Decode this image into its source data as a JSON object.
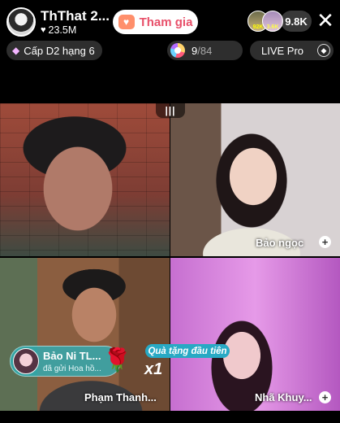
{
  "header": {
    "host_name": "ThThat 2...",
    "host_likes": "23.5M",
    "join_label": "Tham gia",
    "viewer_avatars": [
      "92K",
      "3.6K"
    ],
    "viewer_count": "9.8K",
    "close_label": "✕"
  },
  "badges": {
    "level_label": "Cấp D2 hạng 6",
    "progress_current": "9",
    "progress_total": "/84",
    "live_pro_label": "LIVE Pro"
  },
  "grid": {
    "divider_label": "|||",
    "tiles": [
      {
        "name": ""
      },
      {
        "name": "Bảo ngọc"
      },
      {
        "name": "Phạm Thanh..."
      },
      {
        "name": "Nhã Khuy..."
      }
    ]
  },
  "gift": {
    "sender": "Bảo Ni TL...",
    "message": "đã gửi Hoa hồ...",
    "multiplier": "x1",
    "first_gift_label": "Quà tặng đầu tiên"
  },
  "icons": {
    "heart": "♥",
    "diamond": "◆",
    "rose": "🌹",
    "add": "+",
    "pro": "◆"
  }
}
